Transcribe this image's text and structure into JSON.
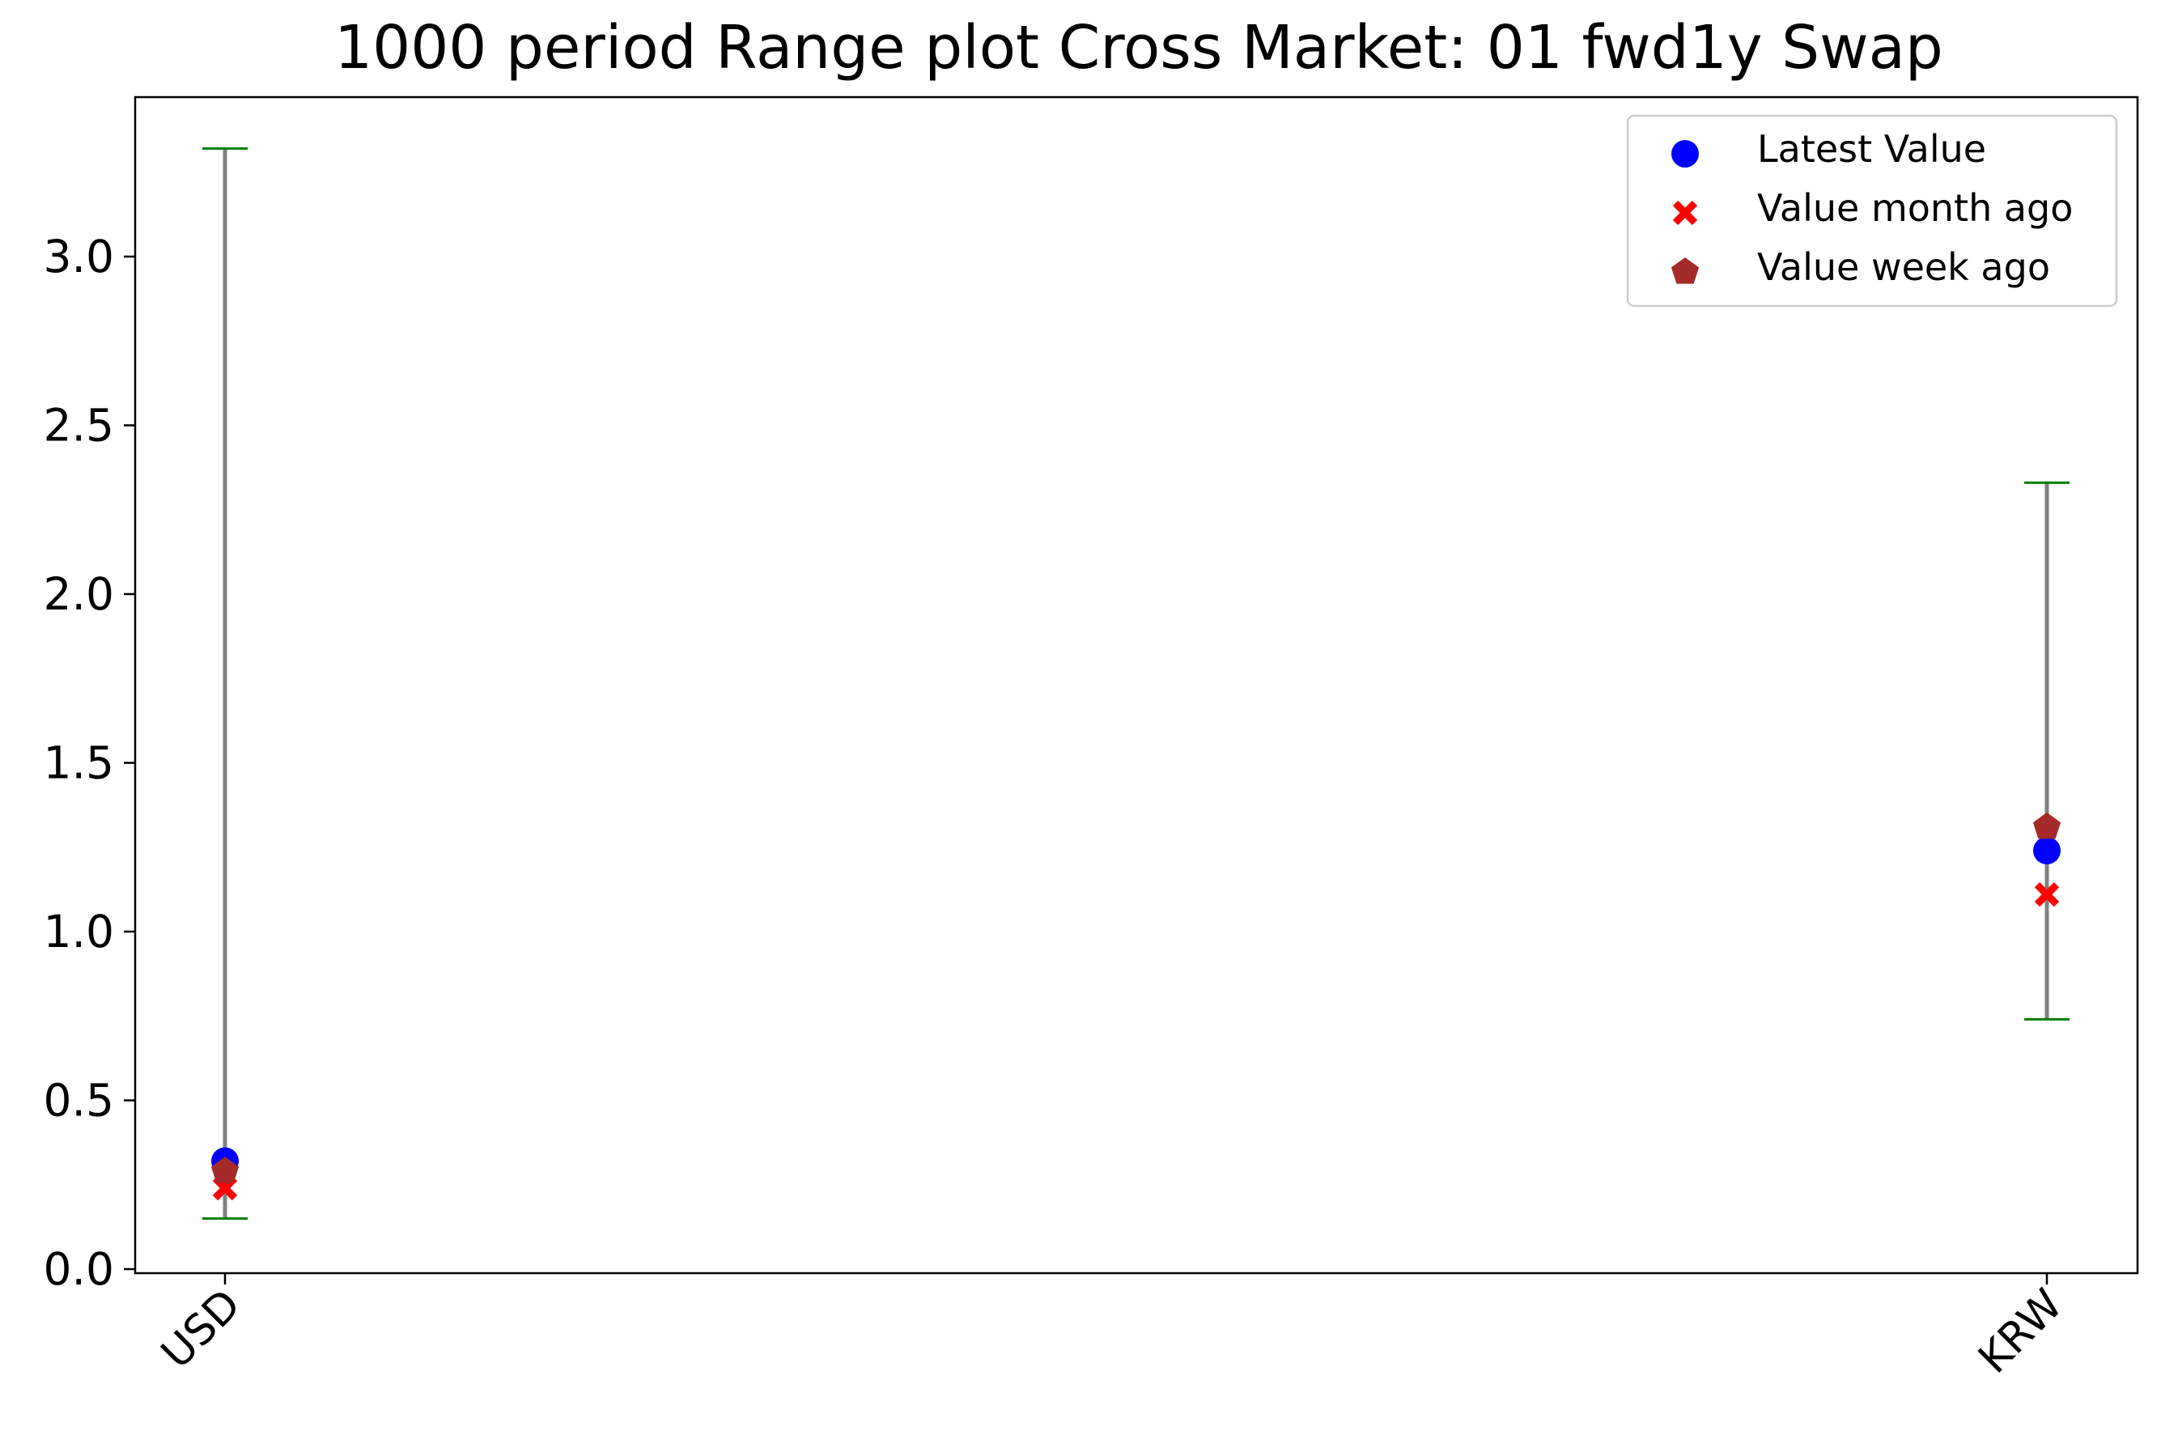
{
  "chart_data": {
    "type": "scatter",
    "title": "1000 period Range plot Cross Market: 01 fwd1y Swap",
    "xlabel": "",
    "ylabel": "",
    "categories": [
      "USD",
      "KRW"
    ],
    "ylim": [
      0.0,
      3.5
    ],
    "yticks": [
      0.0,
      0.5,
      1.0,
      1.5,
      2.0,
      2.5,
      3.0
    ],
    "ytick_labels": [
      "0.0",
      "0.5",
      "1.0",
      "1.5",
      "2.0",
      "2.5",
      "3.0"
    ],
    "grid": false,
    "legend_position": "top-right",
    "range_color": "#808080",
    "cap_color": "#008000",
    "ranges": [
      {
        "category": "USD",
        "min": 0.15,
        "max": 3.32
      },
      {
        "category": "KRW",
        "min": 0.74,
        "max": 2.33
      }
    ],
    "series": [
      {
        "name": "Latest Value",
        "marker": "circle",
        "color": "#0000ff",
        "values": [
          0.32,
          1.24
        ]
      },
      {
        "name": "Value month ago",
        "marker": "x",
        "color": "#ff0000",
        "values": [
          0.24,
          1.11
        ]
      },
      {
        "name": "Value week ago",
        "marker": "pentagon",
        "color": "#a52a2a",
        "values": [
          0.29,
          1.31
        ]
      }
    ]
  }
}
